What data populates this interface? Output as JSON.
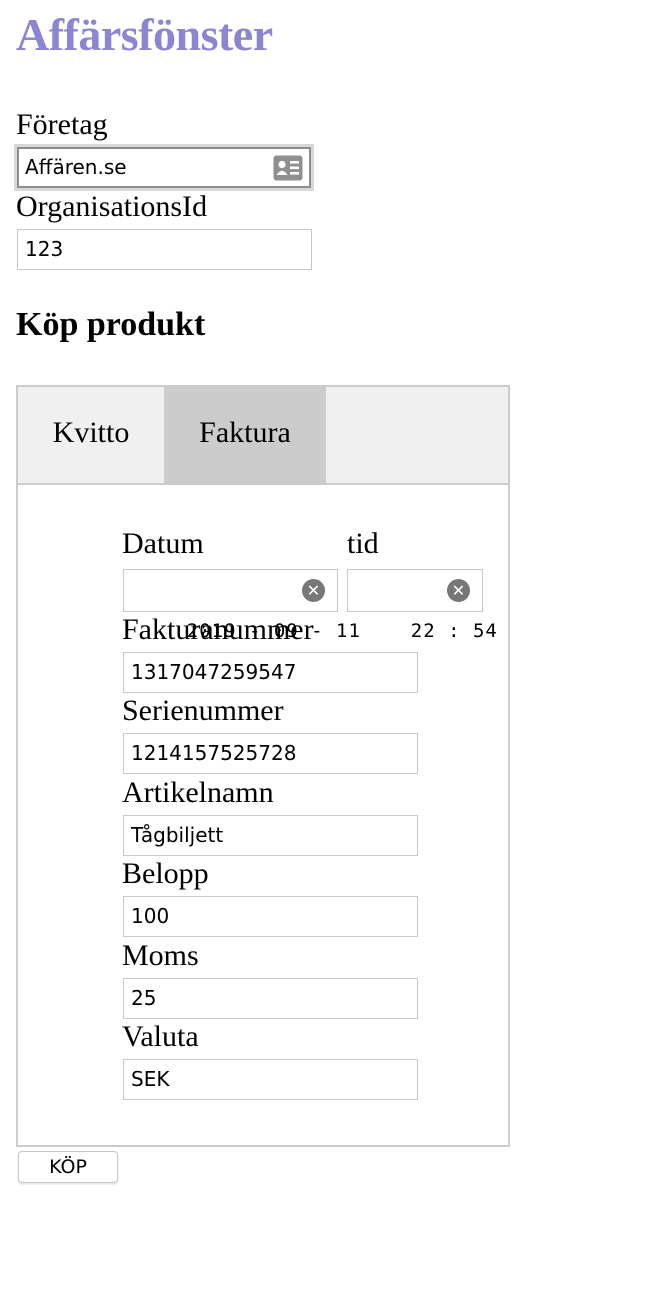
{
  "title": "Affärsfönster",
  "company": {
    "label": "Företag",
    "value": "Affären.se",
    "icon": "contact-card-icon"
  },
  "org": {
    "label": "OrganisationsId",
    "value": "123"
  },
  "section_title": "Köp produkt",
  "tabs": [
    {
      "label": "Kvitto",
      "active": false
    },
    {
      "label": "Faktura",
      "active": true
    }
  ],
  "form": {
    "date_label": "Datum",
    "date_value": "2019 - 09 - 11",
    "time_label": "tid",
    "time_value": "22 : 54",
    "invoice_label": "Fakturanummer",
    "invoice_value": "1317047259547",
    "serial_label": "Serienummer",
    "serial_value": "1214157525728",
    "article_label": "Artikelnamn",
    "article_value": "Tågbiljett",
    "amount_label": "Belopp",
    "amount_value": "100",
    "vat_label": "Moms",
    "vat_value": "25",
    "currency_label": "Valuta",
    "currency_value": "SEK"
  },
  "buy_button": "KÖP",
  "colors": {
    "title": "#8a86d2",
    "active_tab": "#cccccc",
    "tabbar": "#f0f0f0"
  }
}
